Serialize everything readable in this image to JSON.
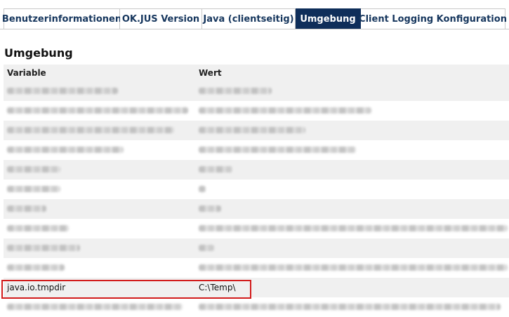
{
  "tabs": [
    {
      "label": "Benutzerinformationen",
      "active": false
    },
    {
      "label": "OK.JUS Version",
      "active": false
    },
    {
      "label": "Java (clientseitig)",
      "active": false
    },
    {
      "label": "Umgebung",
      "active": true
    },
    {
      "label": "Client Logging Konfiguration",
      "active": false
    }
  ],
  "section": {
    "title": "Umgebung"
  },
  "table": {
    "headers": {
      "variable": "Variable",
      "value": "Wert"
    },
    "highlighted_row": {
      "variable": "java.io.tmpdir",
      "value": "C:\\Temp\\"
    }
  },
  "colors": {
    "active_tab": "#0f2e5a",
    "tab_text": "#17375e",
    "highlight": "#d21c1c"
  }
}
